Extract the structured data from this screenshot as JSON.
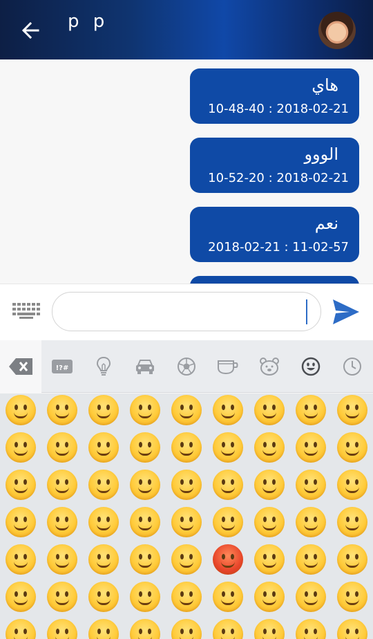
{
  "header": {
    "title": "p p",
    "back_icon": "arrow-left-icon",
    "avatar": "contact-avatar"
  },
  "messages": [
    {
      "text": "هاي",
      "time": "10-48-40 : 2018-02-21"
    },
    {
      "text": "الووو",
      "time": "10-52-20 : 2018-02-21"
    },
    {
      "text": "نعم",
      "time": "2018-02-21 : 11-02-57"
    }
  ],
  "input": {
    "value": "",
    "placeholder": "",
    "keyboard_icon": "keyboard-icon",
    "send_icon": "send-icon"
  },
  "emoji_tabs": [
    "backspace-icon",
    "symbols-icon",
    "lightbulb-icon",
    "car-icon",
    "soccer-ball-icon",
    "coffee-cup-icon",
    "bear-icon",
    "smiley-icon",
    "clock-icon"
  ],
  "emoji_tab_symbols_label": "!?#",
  "selected_tab": "smiley-icon",
  "colors": {
    "accent": "#0f4aa6",
    "header_dark": "#0d1f45",
    "send": "#2d6cc6",
    "keyboard_bg": "#e4e7ea"
  }
}
